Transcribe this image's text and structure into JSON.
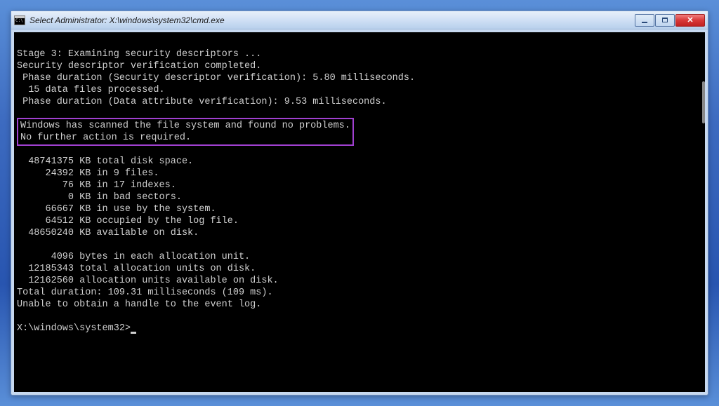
{
  "window": {
    "title": "Select Administrator: X:\\windows\\system32\\cmd.exe"
  },
  "console": {
    "stage_line": "Stage 3: Examining security descriptors ...",
    "sec_completed": "Security descriptor verification completed.",
    "phase_sec": " Phase duration (Security descriptor verification): 5.80 milliseconds.",
    "data_files": "  15 data files processed.",
    "phase_data": " Phase duration (Data attribute verification): 9.53 milliseconds.",
    "highlight_line1": "Windows has scanned the file system and found no problems.",
    "highlight_line2": "No further action is required.",
    "disk_total": "  48741375 KB total disk space.",
    "disk_files": "     24392 KB in 9 files.",
    "disk_indexes": "        76 KB in 17 indexes.",
    "disk_bad": "         0 KB in bad sectors.",
    "disk_system": "     66667 KB in use by the system.",
    "disk_log": "     64512 KB occupied by the log file.",
    "disk_avail": "  48650240 KB available on disk.",
    "alloc_unit": "      4096 bytes in each allocation unit.",
    "alloc_total": "  12185343 total allocation units on disk.",
    "alloc_avail": "  12162560 allocation units available on disk.",
    "total_dur": "Total duration: 109.31 milliseconds (109 ms).",
    "unable": "Unable to obtain a handle to the event log.",
    "prompt": "X:\\windows\\system32>"
  }
}
